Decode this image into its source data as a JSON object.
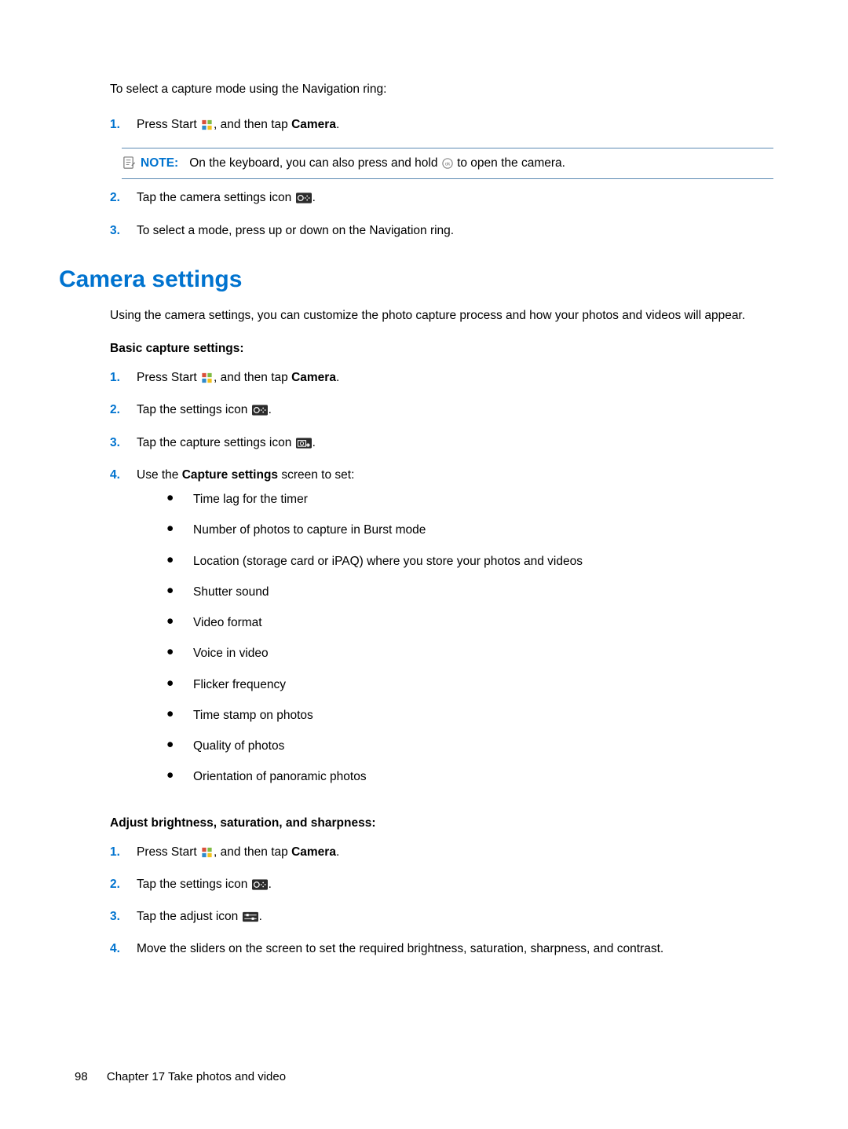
{
  "intro_top": "To select a capture mode using the Navigation ring:",
  "top_steps": {
    "s1_a": "Press Start ",
    "s1_b": ", and then tap ",
    "s1_bold": "Camera",
    "s1_c": ".",
    "s2_a": "Tap the camera settings icon ",
    "s2_b": ".",
    "s3": "To select a mode, press up or down on the Navigation ring."
  },
  "note": {
    "label": "NOTE:",
    "text_a": "On the keyboard, you can also press and hold ",
    "text_b": " to open the camera."
  },
  "heading": "Camera settings",
  "section_intro": "Using the camera settings, you can customize the photo capture process and how your photos and videos will appear.",
  "basic": {
    "heading": "Basic capture settings",
    "s1_a": "Press Start ",
    "s1_b": ", and then tap ",
    "s1_bold": "Camera",
    "s1_c": ".",
    "s2_a": "Tap the settings icon ",
    "s2_b": ".",
    "s3_a": "Tap the capture settings icon ",
    "s3_b": ".",
    "s4_a": "Use the ",
    "s4_bold": "Capture settings",
    "s4_b": " screen to set:",
    "bullets": [
      "Time lag for the timer",
      "Number of photos to capture in Burst mode",
      "Location (storage card or iPAQ) where you store your photos and videos",
      "Shutter sound",
      "Video format",
      "Voice in video",
      "Flicker frequency",
      "Time stamp on photos",
      "Quality of photos",
      "Orientation of panoramic photos"
    ]
  },
  "adjust": {
    "heading": "Adjust brightness, saturation, and sharpness",
    "s1_a": "Press Start ",
    "s1_b": ", and then tap ",
    "s1_bold": "Camera",
    "s1_c": ".",
    "s2_a": "Tap the settings icon ",
    "s2_b": ".",
    "s3_a": "Tap the adjust icon ",
    "s3_b": ".",
    "s4": "Move the sliders on the screen to set the required brightness, saturation, sharpness, and contrast."
  },
  "footer": {
    "page": "98",
    "chapter": "Chapter 17   Take photos and video"
  },
  "nums": {
    "n1": "1.",
    "n2": "2.",
    "n3": "3.",
    "n4": "4."
  },
  "glyphs": {
    "bullet": "●",
    "colon": ":"
  }
}
